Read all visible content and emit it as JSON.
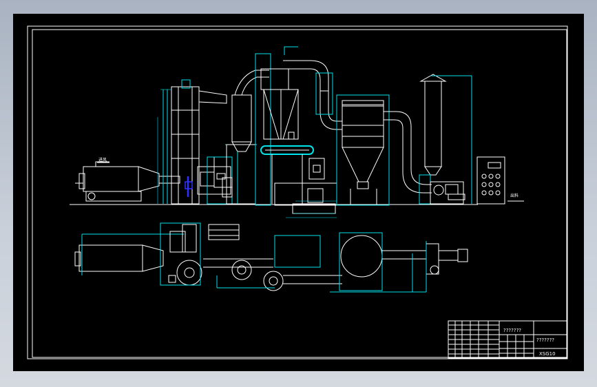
{
  "title_block": {
    "drawing_title": "???????",
    "drawing_name": "???????",
    "drawing_code": "XSG10"
  },
  "labels": {
    "inlet": "进风",
    "outlet": "出料"
  },
  "colors": {
    "background": "#000000",
    "line": "#ffffff",
    "dimension": "#00e5ee",
    "highlight": "#3030ff"
  }
}
